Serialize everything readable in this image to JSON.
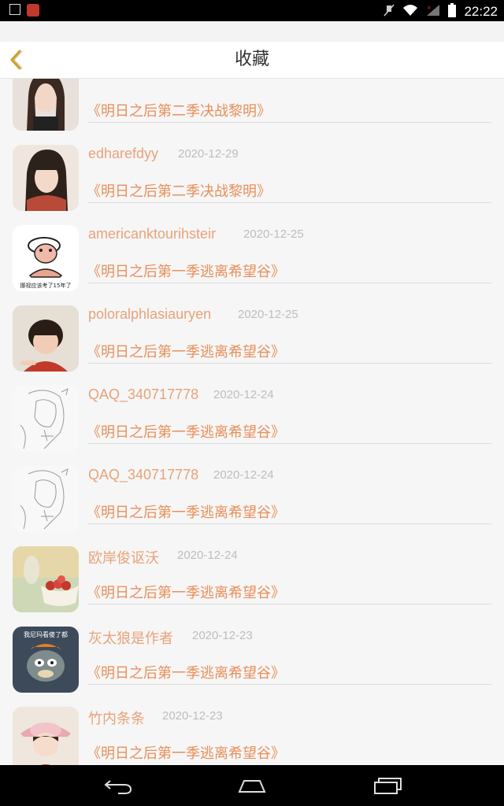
{
  "status_bar": {
    "time": "22:22",
    "icons": [
      "image-icon",
      "app-icon",
      "mute-icon",
      "wifi-icon",
      "signal-icon",
      "battery-icon"
    ]
  },
  "header": {
    "title": "收藏",
    "back_icon": "chevron-left-icon",
    "accent_color": "#d4a017"
  },
  "items": [
    {
      "user": "",
      "date": "",
      "work": "《明日之后第二季决战黎明》",
      "avatar": "girl-photo-avatar"
    },
    {
      "user": "edharefdyy",
      "date": "2020-12-29",
      "work": "《明日之后第二季决战黎明》",
      "avatar": "girl-photo-avatar"
    },
    {
      "user": "americanktourihsteir",
      "date": "2020-12-25",
      "work": "《明日之后第一季逃离希望谷》",
      "avatar": "cartoon-meme-avatar"
    },
    {
      "user": "poloralphlasiauryen",
      "date": "2020-12-25",
      "work": "《明日之后第一季逃离希望谷》",
      "avatar": "child-photo-avatar"
    },
    {
      "user": "QAQ_340717778",
      "date": "2020-12-24",
      "work": "《明日之后第一季逃离希望谷》",
      "avatar": "sketch-avatar"
    },
    {
      "user": "QAQ_340717778",
      "date": "2020-12-24",
      "work": "《明日之后第一季逃离希望谷》",
      "avatar": "sketch-avatar"
    },
    {
      "user": "欧岸俊讴沃",
      "date": "2020-12-24",
      "work": "《明日之后第一季逃离希望谷》",
      "avatar": "fruit-bowl-avatar"
    },
    {
      "user": "灰太狼是作者",
      "date": "2020-12-23",
      "work": "《明日之后第一季逃离希望谷》",
      "avatar": "wolf-cartoon-avatar"
    },
    {
      "user": "竹内条条",
      "date": "2020-12-23",
      "work": "《明日之后第一季逃离希望谷》",
      "avatar": "doll-avatar"
    }
  ],
  "avatar_texts": {
    "meme": "挪视应该考了15年了",
    "wolf": "我尼玛看傻了都"
  },
  "nav_bar": {
    "buttons": [
      "back-nav-icon",
      "home-nav-icon",
      "recents-nav-icon"
    ]
  }
}
